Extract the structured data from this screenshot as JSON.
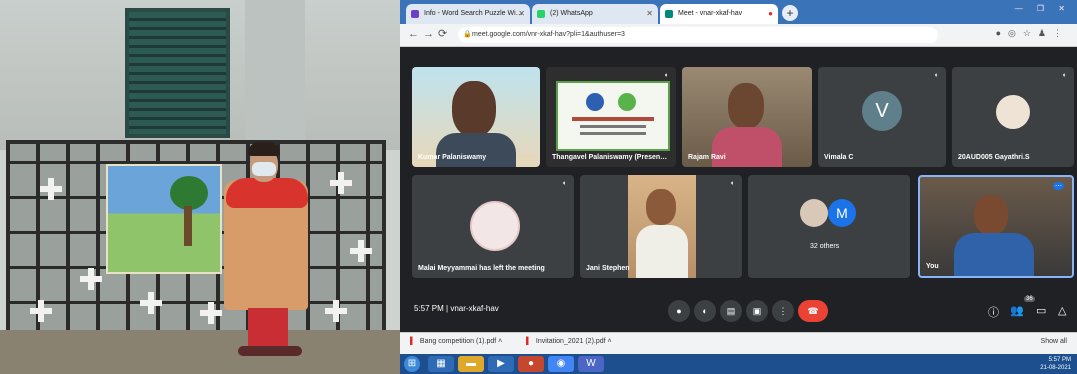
{
  "browser": {
    "tabs": [
      {
        "label": "Info - Word Search Puzzle Wi…",
        "color": "#6b3fc6"
      },
      {
        "label": "(2) WhatsApp",
        "color": "#25d366"
      },
      {
        "label": "Meet - vnar-xkaf-hav",
        "color": "#00897b"
      }
    ],
    "url": "meet.google.com/vnr-xkaf-hav?pli=1&authuser=3",
    "window_controls": "— ❐ ✕"
  },
  "meet": {
    "participants": [
      {
        "name": "Kumar Palaniswamy",
        "kind": "video"
      },
      {
        "name": "Thangavel Palaniswamy (Presen…",
        "kind": "presentation"
      },
      {
        "name": "Rajam Ravi",
        "kind": "video"
      },
      {
        "name": "Vimala C",
        "kind": "avatar",
        "initial": "V",
        "color": "#5f7f8a"
      },
      {
        "name": "20AUD005 Gayathri.S",
        "kind": "photo-avatar"
      },
      {
        "name": "Malai Meyyammai has left the meeting",
        "kind": "photo-avatar"
      },
      {
        "name": "Jani Stephen",
        "kind": "video"
      },
      {
        "name": "32 others",
        "kind": "others",
        "initial": "M",
        "color": "#1a73e8"
      },
      {
        "name": "You",
        "kind": "video"
      }
    ],
    "time": "5:57 PM",
    "separator": "|",
    "meeting_code": "vnar-xkaf-hav",
    "participant_count": "36"
  },
  "downloads": {
    "items": [
      "Bang competition (1).pdf",
      "Invitation_2021 (2).pdf"
    ],
    "show_all": "Show all"
  },
  "taskbar": {
    "time": "5:57 PM",
    "date": "21-08-2021"
  }
}
